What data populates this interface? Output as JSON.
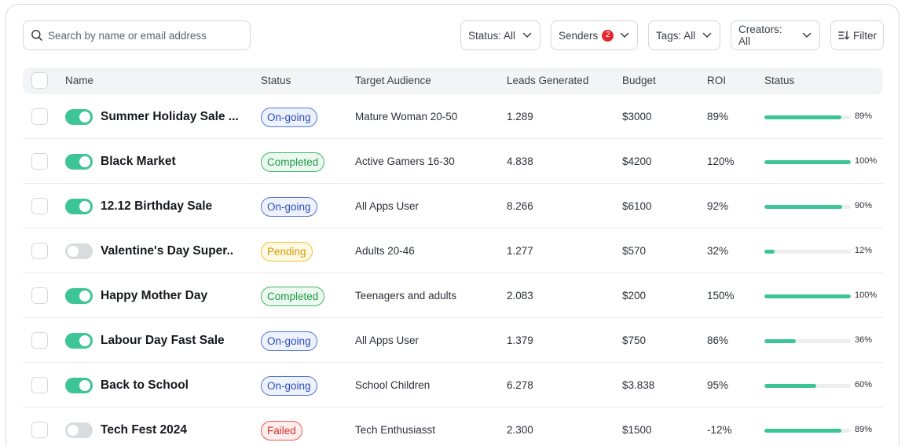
{
  "search": {
    "placeholder": "Search by name or email address"
  },
  "filters": {
    "status": "Status: All",
    "senders": "Senders",
    "senders_count": "2",
    "tags": "Tags: All",
    "creators": "Creators: All",
    "filter": "Filter"
  },
  "columns": {
    "name": "Name",
    "status": "Status",
    "audience": "Target Audience",
    "leads": "Leads Generated",
    "budget": "Budget",
    "roi": "ROI",
    "progress": "Status"
  },
  "colors": {
    "accent": "#3ec597",
    "ongoing": "#5277d6",
    "completed": "#3fb767",
    "pending": "#f2c42c",
    "failed": "#ec5454"
  },
  "rows": [
    {
      "enabled": true,
      "name": "Summer Holiday Sale ...",
      "status": "On-going",
      "status_kind": "ongoing",
      "audience": "Mature Woman 20-50",
      "leads": "1.289",
      "budget": "$3000",
      "roi": "89%",
      "progress": 89,
      "progress_label": "89%"
    },
    {
      "enabled": true,
      "name": "Black Market",
      "status": "Completed",
      "status_kind": "completed",
      "audience": "Active Gamers 16-30",
      "leads": "4.838",
      "budget": "$4200",
      "roi": "120%",
      "progress": 100,
      "progress_label": "100%"
    },
    {
      "enabled": true,
      "name": "12.12 Birthday Sale",
      "status": "On-going",
      "status_kind": "ongoing",
      "audience": "All Apps User",
      "leads": "8.266",
      "budget": "$6100",
      "roi": "92%",
      "progress": 90,
      "progress_label": "90%"
    },
    {
      "enabled": false,
      "name": "Valentine's Day Super..",
      "status": "Pending",
      "status_kind": "pending",
      "audience": "Adults 20-46",
      "leads": "1.277",
      "budget": "$570",
      "roi": "32%",
      "progress": 12,
      "progress_label": "12%"
    },
    {
      "enabled": true,
      "name": "Happy Mother Day",
      "status": "Completed",
      "status_kind": "completed",
      "audience": "Teenagers and adults",
      "leads": "2.083",
      "budget": "$200",
      "roi": "150%",
      "progress": 100,
      "progress_label": "100%"
    },
    {
      "enabled": true,
      "name": "Labour Day Fast Sale",
      "status": "On-going",
      "status_kind": "ongoing",
      "audience": "All Apps User",
      "leads": "1.379",
      "budget": "$750",
      "roi": "86%",
      "progress": 36,
      "progress_label": "36%"
    },
    {
      "enabled": true,
      "name": "Back to School",
      "status": "On-going",
      "status_kind": "ongoing",
      "audience": "School Children",
      "leads": "6.278",
      "budget": "$3.838",
      "roi": "95%",
      "progress": 60,
      "progress_label": "60%"
    },
    {
      "enabled": false,
      "name": "Tech Fest 2024",
      "status": "Failed",
      "status_kind": "failed",
      "audience": "Tech Enthusiasst",
      "leads": "2.300",
      "budget": "$1500",
      "roi": "-12%",
      "progress": 89,
      "progress_label": "89%"
    }
  ]
}
